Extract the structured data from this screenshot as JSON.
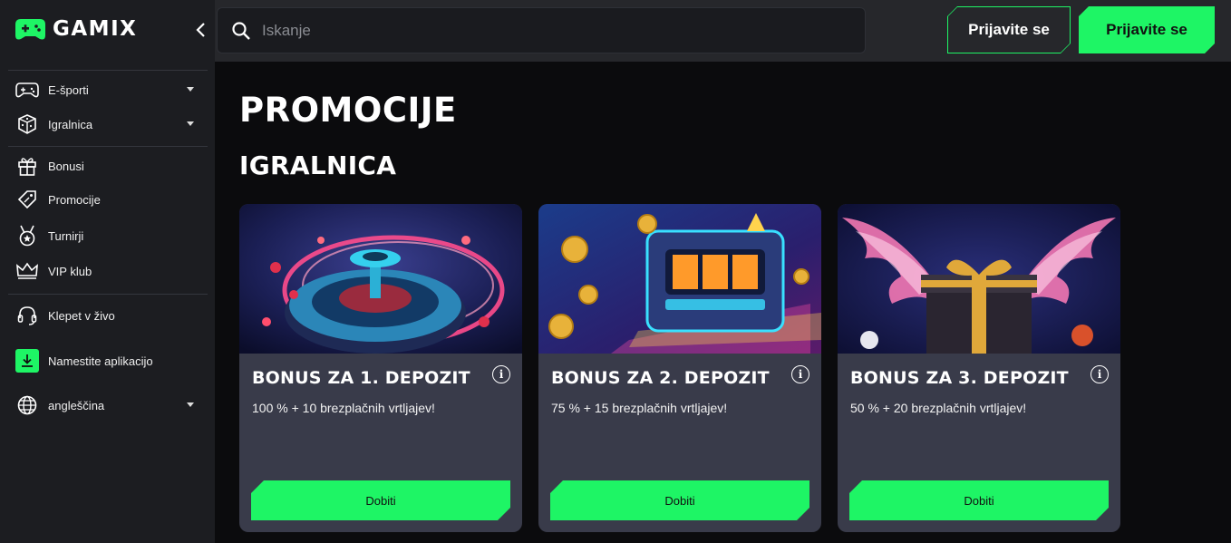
{
  "brand": {
    "name": "GAMIX",
    "accent": "#1ef565"
  },
  "sidebar": {
    "items": [
      {
        "label": "E-športi",
        "icon": "gamepad-icon",
        "has_caret": true
      },
      {
        "label": "Igralnica",
        "icon": "dice-icon",
        "has_caret": true
      },
      {
        "label": "Bonusi",
        "icon": "gift-icon",
        "has_caret": false
      },
      {
        "label": "Promocije",
        "icon": "tag-icon",
        "has_caret": false
      },
      {
        "label": "Turnirji",
        "icon": "medal-icon",
        "has_caret": false
      },
      {
        "label": "VIP klub",
        "icon": "crown-icon",
        "has_caret": false
      },
      {
        "label": "Klepet v živo",
        "icon": "headset-icon",
        "has_caret": false
      },
      {
        "label": "Namestite aplikacijo",
        "icon": "download-icon",
        "has_caret": false
      },
      {
        "label": "angleščina",
        "icon": "globe-icon",
        "has_caret": true
      }
    ]
  },
  "header": {
    "search_placeholder": "Iskanje",
    "login_label": "Prijavite se",
    "register_label": "Prijavite se"
  },
  "main": {
    "page_title": "PROMOCIJE",
    "section_title": "IGRALNICA",
    "cards": [
      {
        "title": "BONUS ZA 1. DEPOZIT",
        "description": "100 % + 10 brezplačnih vrtljajev!",
        "cta": "Dobiti",
        "art": "roulette"
      },
      {
        "title": "BONUS ZA 2. DEPOZIT",
        "description": "75 % + 15 brezplačnih vrtljajev!",
        "cta": "Dobiti",
        "art": "slot-machine"
      },
      {
        "title": "BONUS ZA 3. DEPOZIT",
        "description": "50 % + 20 brezplačnih vrtljajev!",
        "cta": "Dobiti",
        "art": "winged-gift"
      }
    ]
  }
}
